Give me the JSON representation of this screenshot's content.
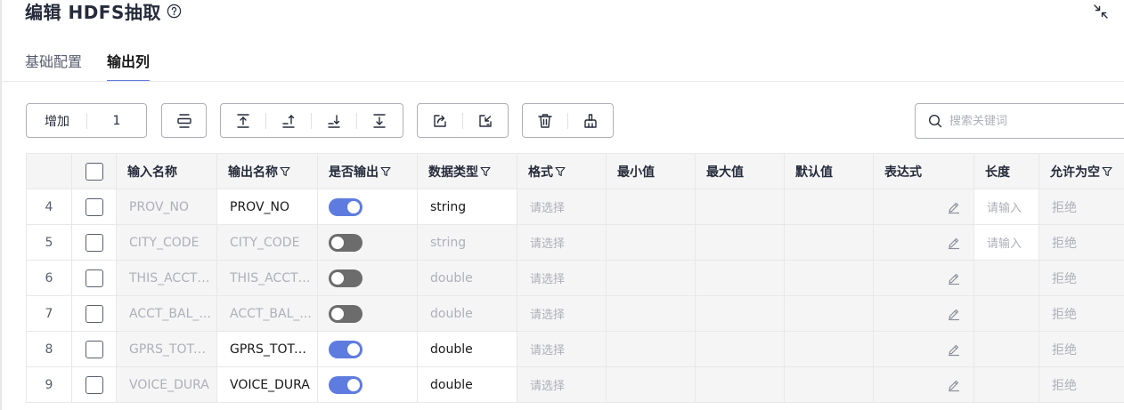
{
  "header": {
    "title": "编辑 HDFS抽取"
  },
  "tabs": [
    {
      "label": "基础配置",
      "active": false
    },
    {
      "label": "输出列",
      "active": true
    }
  ],
  "toolbar": {
    "add_label": "增加",
    "add_count": "1",
    "buttons": [
      "insert-row-icon",
      "move-to-top-icon",
      "move-up-icon",
      "move-down-icon",
      "move-to-bottom-icon",
      "export-icon",
      "import-icon",
      "delete-icon",
      "clear-icon"
    ]
  },
  "search": {
    "placeholder": "搜索关键词",
    "value": ""
  },
  "table": {
    "columns": [
      "",
      "",
      "输入名称",
      "输出名称",
      "是否输出",
      "数据类型",
      "格式",
      "最小值",
      "最大值",
      "默认值",
      "表达式",
      "长度",
      "允许为空"
    ],
    "rows": [
      {
        "index": "4",
        "input_name": "PROV_NO",
        "output_name": "PROV_NO",
        "output_enabled": true,
        "data_type": "string",
        "format": "请选择",
        "length": "请输入",
        "nullable": "拒绝"
      },
      {
        "index": "5",
        "input_name": "CITY_CODE",
        "output_name": "CITY_CODE",
        "output_enabled": false,
        "data_type": "string",
        "format": "请选择",
        "length": "请输入",
        "nullable": "拒绝"
      },
      {
        "index": "6",
        "input_name": "THIS_ACCT_...",
        "output_name": "THIS_ACCT_...",
        "output_enabled": false,
        "data_type": "double",
        "format": "请选择",
        "length": "",
        "nullable": "拒绝"
      },
      {
        "index": "7",
        "input_name": "ACCT_BAL_...",
        "output_name": "ACCT_BAL_...",
        "output_enabled": false,
        "data_type": "double",
        "format": "请选择",
        "length": "",
        "nullable": "拒绝"
      },
      {
        "index": "8",
        "input_name": "GPRS_TOTA...",
        "output_name": "GPRS_TOTA...",
        "output_enabled": true,
        "data_type": "double",
        "format": "请选择",
        "length": "",
        "nullable": "拒绝"
      },
      {
        "index": "9",
        "input_name": "VOICE_DURA",
        "output_name": "VOICE_DURA",
        "output_enabled": true,
        "data_type": "double",
        "format": "请选择",
        "length": "",
        "nullable": "拒绝"
      }
    ]
  },
  "colors": {
    "accent": "#5e7ce0",
    "switch_off": "#6c6c6c",
    "disabled_text": "#adb0b8",
    "cell_gray": "#f5f5f6",
    "border": "#e8e8e8"
  }
}
